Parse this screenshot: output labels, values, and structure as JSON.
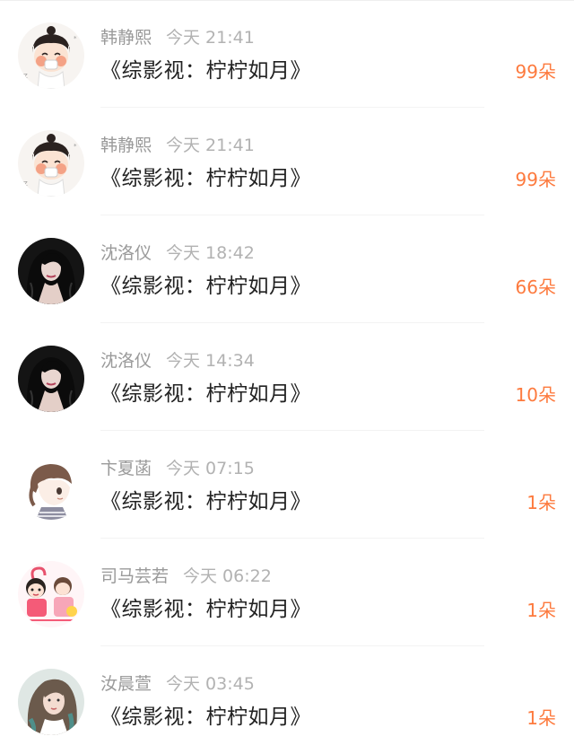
{
  "colors": {
    "accent": "#fd7a3e",
    "name_text": "#9a9a9a",
    "title_text": "#222222"
  },
  "items": [
    {
      "name": "韩静熙",
      "time": "今天 21:41",
      "title": "《综影视：柠柠如月》",
      "count": "99朵",
      "avatar": "cartoon-girl-avatar"
    },
    {
      "name": "韩静熙",
      "time": "今天 21:41",
      "title": "《综影视：柠柠如月》",
      "count": "99朵",
      "avatar": "cartoon-girl-avatar"
    },
    {
      "name": "沈洛仪",
      "time": "今天 18:42",
      "title": "《综影视：柠柠如月》",
      "count": "66朵",
      "avatar": "dark-hair-portrait-avatar"
    },
    {
      "name": "沈洛仪",
      "time": "今天 14:34",
      "title": "《综影视：柠柠如月》",
      "count": "10朵",
      "avatar": "dark-hair-portrait-avatar"
    },
    {
      "name": "卞夏菡",
      "time": "今天 07:15",
      "title": "《综影视：柠柠如月》",
      "count": "1朵",
      "avatar": "anime-girl-profile-avatar"
    },
    {
      "name": "司马芸若",
      "time": "今天 06:22",
      "title": "《综影视：柠柠如月》",
      "count": "1朵",
      "avatar": "pink-cartoon-couple-avatar"
    },
    {
      "name": "汝晨萱",
      "time": "今天 03:45",
      "title": "《综影视：柠柠如月》",
      "count": "1朵",
      "avatar": "woman-photo-avatar"
    }
  ]
}
